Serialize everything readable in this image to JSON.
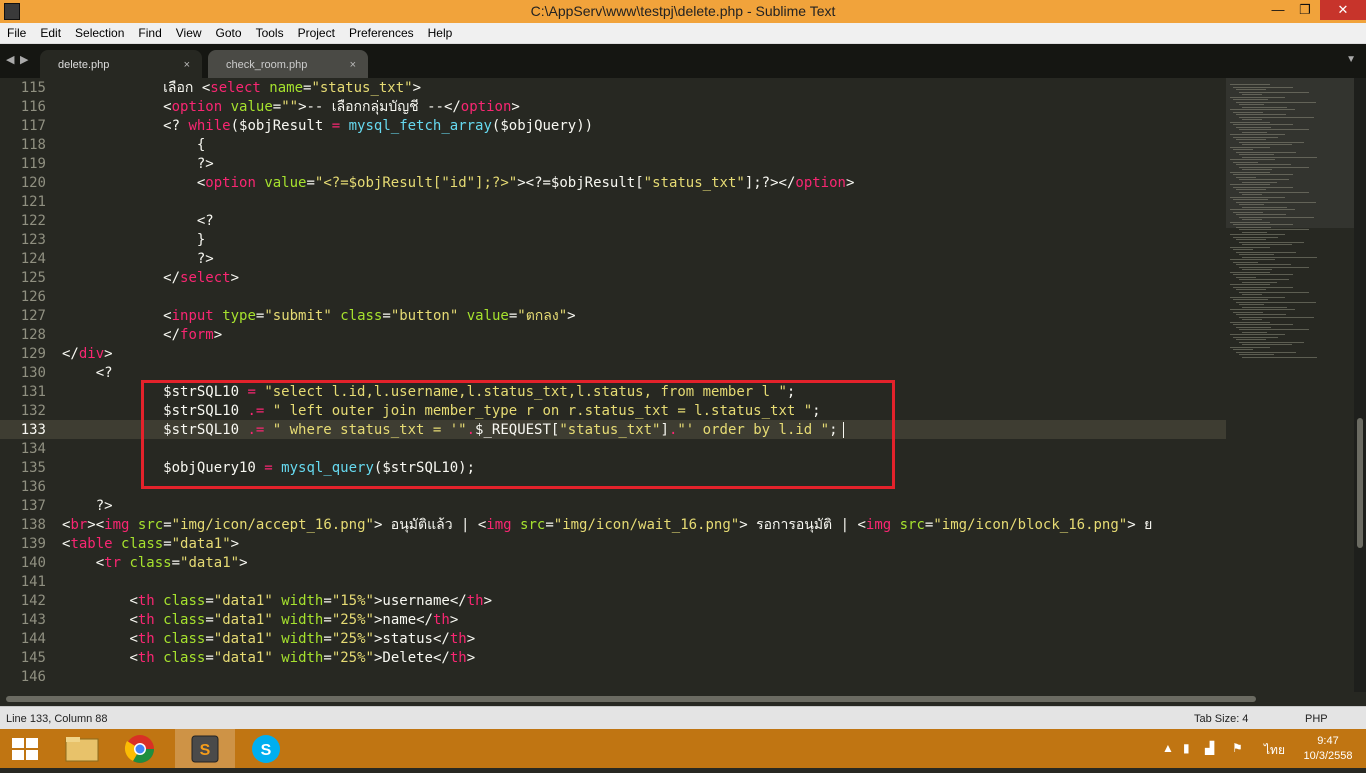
{
  "window": {
    "title": "C:\\AppServ\\www\\testpj\\delete.php - Sublime Text",
    "minimize": "—",
    "maximize": "❐",
    "close": "✕"
  },
  "menu": [
    "File",
    "Edit",
    "Selection",
    "Find",
    "View",
    "Goto",
    "Tools",
    "Project",
    "Preferences",
    "Help"
  ],
  "tabs": {
    "nav_left": "◀",
    "nav_right": "▶",
    "items": [
      {
        "label": "delete.php",
        "close": "×",
        "active": true
      },
      {
        "label": "check_room.php",
        "close": "×",
        "active": false
      }
    ],
    "dropdown": "▼"
  },
  "editor": {
    "current_line": "133",
    "lines": [
      {
        "n": "115",
        "tokens": [
          {
            "t": "text",
            "v": "            เลือก "
          },
          {
            "t": "punc",
            "v": "<"
          },
          {
            "t": "tag",
            "v": "select"
          },
          {
            "t": "text",
            "v": " "
          },
          {
            "t": "attr",
            "v": "name"
          },
          {
            "t": "punc",
            "v": "="
          },
          {
            "t": "str",
            "v": "\"status_txt\""
          },
          {
            "t": "punc",
            "v": ">"
          }
        ]
      },
      {
        "n": "116",
        "tokens": [
          {
            "t": "text",
            "v": "            "
          },
          {
            "t": "punc",
            "v": "<"
          },
          {
            "t": "tag",
            "v": "option"
          },
          {
            "t": "text",
            "v": " "
          },
          {
            "t": "attr",
            "v": "value"
          },
          {
            "t": "punc",
            "v": "="
          },
          {
            "t": "str",
            "v": "\"\""
          },
          {
            "t": "punc",
            "v": ">"
          },
          {
            "t": "text",
            "v": "-- เลือกกลุ่มบัญชี --"
          },
          {
            "t": "punc",
            "v": "</"
          },
          {
            "t": "tag",
            "v": "option"
          },
          {
            "t": "punc",
            "v": ">"
          }
        ]
      },
      {
        "n": "117",
        "tokens": [
          {
            "t": "text",
            "v": "            <? "
          },
          {
            "t": "kw",
            "v": "while"
          },
          {
            "t": "text",
            "v": "($objResult "
          },
          {
            "t": "op",
            "v": "="
          },
          {
            "t": "text",
            "v": " "
          },
          {
            "t": "func",
            "v": "mysql_fetch_array"
          },
          {
            "t": "text",
            "v": "($objQuery))"
          }
        ]
      },
      {
        "n": "118",
        "tokens": [
          {
            "t": "text",
            "v": "                {"
          }
        ]
      },
      {
        "n": "119",
        "tokens": [
          {
            "t": "text",
            "v": "                ?>"
          }
        ]
      },
      {
        "n": "120",
        "tokens": [
          {
            "t": "text",
            "v": "                "
          },
          {
            "t": "punc",
            "v": "<"
          },
          {
            "t": "tag",
            "v": "option"
          },
          {
            "t": "text",
            "v": " "
          },
          {
            "t": "attr",
            "v": "value"
          },
          {
            "t": "punc",
            "v": "="
          },
          {
            "t": "str",
            "v": "\"<?=$objResult[\"id\"];?>\""
          },
          {
            "t": "punc",
            "v": ">"
          },
          {
            "t": "text",
            "v": "<?=$objResult["
          },
          {
            "t": "str",
            "v": "\"status_txt\""
          },
          {
            "t": "text",
            "v": "];?>"
          },
          {
            "t": "punc",
            "v": "</"
          },
          {
            "t": "tag",
            "v": "option"
          },
          {
            "t": "punc",
            "v": ">"
          }
        ]
      },
      {
        "n": "121",
        "tokens": []
      },
      {
        "n": "122",
        "tokens": [
          {
            "t": "text",
            "v": "                <?"
          }
        ]
      },
      {
        "n": "123",
        "tokens": [
          {
            "t": "text",
            "v": "                }"
          }
        ]
      },
      {
        "n": "124",
        "tokens": [
          {
            "t": "text",
            "v": "                ?>"
          }
        ]
      },
      {
        "n": "125",
        "tokens": [
          {
            "t": "text",
            "v": "            "
          },
          {
            "t": "punc",
            "v": "</"
          },
          {
            "t": "tag",
            "v": "select"
          },
          {
            "t": "punc",
            "v": ">"
          }
        ]
      },
      {
        "n": "126",
        "tokens": []
      },
      {
        "n": "127",
        "tokens": [
          {
            "t": "text",
            "v": "            "
          },
          {
            "t": "punc",
            "v": "<"
          },
          {
            "t": "tag",
            "v": "input"
          },
          {
            "t": "text",
            "v": " "
          },
          {
            "t": "attr",
            "v": "type"
          },
          {
            "t": "punc",
            "v": "="
          },
          {
            "t": "str",
            "v": "\"submit\""
          },
          {
            "t": "text",
            "v": " "
          },
          {
            "t": "attr",
            "v": "class"
          },
          {
            "t": "punc",
            "v": "="
          },
          {
            "t": "str",
            "v": "\"button\""
          },
          {
            "t": "text",
            "v": " "
          },
          {
            "t": "attr",
            "v": "value"
          },
          {
            "t": "punc",
            "v": "="
          },
          {
            "t": "str",
            "v": "\"ตกลง\""
          },
          {
            "t": "punc",
            "v": ">"
          }
        ]
      },
      {
        "n": "128",
        "tokens": [
          {
            "t": "text",
            "v": "            "
          },
          {
            "t": "punc",
            "v": "</"
          },
          {
            "t": "tag",
            "v": "form"
          },
          {
            "t": "punc",
            "v": ">"
          }
        ]
      },
      {
        "n": "129",
        "tokens": [
          {
            "t": "punc",
            "v": "</"
          },
          {
            "t": "tag",
            "v": "div"
          },
          {
            "t": "punc",
            "v": ">"
          }
        ]
      },
      {
        "n": "130",
        "tokens": [
          {
            "t": "text",
            "v": "    <?"
          }
        ]
      },
      {
        "n": "131",
        "tokens": [
          {
            "t": "text",
            "v": "            $strSQL10 "
          },
          {
            "t": "op",
            "v": "="
          },
          {
            "t": "text",
            "v": " "
          },
          {
            "t": "str",
            "v": "\"select l.id,l.username,l.status_txt,l.status, from member l \""
          },
          {
            "t": "text",
            "v": ";"
          }
        ]
      },
      {
        "n": "132",
        "tokens": [
          {
            "t": "text",
            "v": "            $strSQL10 "
          },
          {
            "t": "op",
            "v": ".="
          },
          {
            "t": "text",
            "v": " "
          },
          {
            "t": "str",
            "v": "\" left outer join member_type r on r.status_txt = l.status_txt \""
          },
          {
            "t": "text",
            "v": ";"
          }
        ]
      },
      {
        "n": "133",
        "tokens": [
          {
            "t": "text",
            "v": "            $strSQL10 "
          },
          {
            "t": "op",
            "v": ".="
          },
          {
            "t": "text",
            "v": " "
          },
          {
            "t": "str",
            "v": "\" where status_txt = '\""
          },
          {
            "t": "op",
            "v": "."
          },
          {
            "t": "text",
            "v": "$_REQUEST["
          },
          {
            "t": "str",
            "v": "\"status_txt\""
          },
          {
            "t": "text",
            "v": "]"
          },
          {
            "t": "op",
            "v": "."
          },
          {
            "t": "str",
            "v": "\"' order by l.id \""
          },
          {
            "t": "text",
            "v": ";"
          }
        ]
      },
      {
        "n": "134",
        "tokens": []
      },
      {
        "n": "135",
        "tokens": [
          {
            "t": "text",
            "v": "            $objQuery10 "
          },
          {
            "t": "op",
            "v": "="
          },
          {
            "t": "text",
            "v": " "
          },
          {
            "t": "func",
            "v": "mysql_query"
          },
          {
            "t": "text",
            "v": "($strSQL10);"
          }
        ]
      },
      {
        "n": "136",
        "tokens": []
      },
      {
        "n": "137",
        "tokens": [
          {
            "t": "text",
            "v": "    ?>"
          }
        ]
      },
      {
        "n": "138",
        "tokens": [
          {
            "t": "punc",
            "v": "<"
          },
          {
            "t": "tag",
            "v": "br"
          },
          {
            "t": "punc",
            "v": ">"
          },
          {
            "t": "punc",
            "v": "<"
          },
          {
            "t": "tag",
            "v": "img"
          },
          {
            "t": "text",
            "v": " "
          },
          {
            "t": "attr",
            "v": "src"
          },
          {
            "t": "punc",
            "v": "="
          },
          {
            "t": "str",
            "v": "\"img/icon/accept_16.png\""
          },
          {
            "t": "punc",
            "v": ">"
          },
          {
            "t": "text",
            "v": " อนุมัติแล้ว | "
          },
          {
            "t": "punc",
            "v": "<"
          },
          {
            "t": "tag",
            "v": "img"
          },
          {
            "t": "text",
            "v": " "
          },
          {
            "t": "attr",
            "v": "src"
          },
          {
            "t": "punc",
            "v": "="
          },
          {
            "t": "str",
            "v": "\"img/icon/wait_16.png\""
          },
          {
            "t": "punc",
            "v": ">"
          },
          {
            "t": "text",
            "v": " รอการอนุมัติ | "
          },
          {
            "t": "punc",
            "v": "<"
          },
          {
            "t": "tag",
            "v": "img"
          },
          {
            "t": "text",
            "v": " "
          },
          {
            "t": "attr",
            "v": "src"
          },
          {
            "t": "punc",
            "v": "="
          },
          {
            "t": "str",
            "v": "\"img/icon/block_16.png\""
          },
          {
            "t": "punc",
            "v": ">"
          },
          {
            "t": "text",
            "v": " ย"
          }
        ]
      },
      {
        "n": "139",
        "tokens": [
          {
            "t": "punc",
            "v": "<"
          },
          {
            "t": "tag",
            "v": "table"
          },
          {
            "t": "text",
            "v": " "
          },
          {
            "t": "attr",
            "v": "class"
          },
          {
            "t": "punc",
            "v": "="
          },
          {
            "t": "str",
            "v": "\"data1\""
          },
          {
            "t": "punc",
            "v": ">"
          }
        ]
      },
      {
        "n": "140",
        "tokens": [
          {
            "t": "text",
            "v": "    "
          },
          {
            "t": "punc",
            "v": "<"
          },
          {
            "t": "tag",
            "v": "tr"
          },
          {
            "t": "text",
            "v": " "
          },
          {
            "t": "attr",
            "v": "class"
          },
          {
            "t": "punc",
            "v": "="
          },
          {
            "t": "str",
            "v": "\"data1\""
          },
          {
            "t": "punc",
            "v": ">"
          }
        ]
      },
      {
        "n": "141",
        "tokens": []
      },
      {
        "n": "142",
        "tokens": [
          {
            "t": "text",
            "v": "        "
          },
          {
            "t": "punc",
            "v": "<"
          },
          {
            "t": "tag",
            "v": "th"
          },
          {
            "t": "text",
            "v": " "
          },
          {
            "t": "attr",
            "v": "class"
          },
          {
            "t": "punc",
            "v": "="
          },
          {
            "t": "str",
            "v": "\"data1\""
          },
          {
            "t": "text",
            "v": " "
          },
          {
            "t": "attr",
            "v": "width"
          },
          {
            "t": "punc",
            "v": "="
          },
          {
            "t": "str",
            "v": "\"15%\""
          },
          {
            "t": "punc",
            "v": ">"
          },
          {
            "t": "text",
            "v": "username"
          },
          {
            "t": "punc",
            "v": "</"
          },
          {
            "t": "tag",
            "v": "th"
          },
          {
            "t": "punc",
            "v": ">"
          }
        ]
      },
      {
        "n": "143",
        "tokens": [
          {
            "t": "text",
            "v": "        "
          },
          {
            "t": "punc",
            "v": "<"
          },
          {
            "t": "tag",
            "v": "th"
          },
          {
            "t": "text",
            "v": " "
          },
          {
            "t": "attr",
            "v": "class"
          },
          {
            "t": "punc",
            "v": "="
          },
          {
            "t": "str",
            "v": "\"data1\""
          },
          {
            "t": "text",
            "v": " "
          },
          {
            "t": "attr",
            "v": "width"
          },
          {
            "t": "punc",
            "v": "="
          },
          {
            "t": "str",
            "v": "\"25%\""
          },
          {
            "t": "punc",
            "v": ">"
          },
          {
            "t": "text",
            "v": "name"
          },
          {
            "t": "punc",
            "v": "</"
          },
          {
            "t": "tag",
            "v": "th"
          },
          {
            "t": "punc",
            "v": ">"
          }
        ]
      },
      {
        "n": "144",
        "tokens": [
          {
            "t": "text",
            "v": "        "
          },
          {
            "t": "punc",
            "v": "<"
          },
          {
            "t": "tag",
            "v": "th"
          },
          {
            "t": "text",
            "v": " "
          },
          {
            "t": "attr",
            "v": "class"
          },
          {
            "t": "punc",
            "v": "="
          },
          {
            "t": "str",
            "v": "\"data1\""
          },
          {
            "t": "text",
            "v": " "
          },
          {
            "t": "attr",
            "v": "width"
          },
          {
            "t": "punc",
            "v": "="
          },
          {
            "t": "str",
            "v": "\"25%\""
          },
          {
            "t": "punc",
            "v": ">"
          },
          {
            "t": "text",
            "v": "status"
          },
          {
            "t": "punc",
            "v": "</"
          },
          {
            "t": "tag",
            "v": "th"
          },
          {
            "t": "punc",
            "v": ">"
          }
        ]
      },
      {
        "n": "145",
        "tokens": [
          {
            "t": "text",
            "v": "        "
          },
          {
            "t": "punc",
            "v": "<"
          },
          {
            "t": "tag",
            "v": "th"
          },
          {
            "t": "text",
            "v": " "
          },
          {
            "t": "attr",
            "v": "class"
          },
          {
            "t": "punc",
            "v": "="
          },
          {
            "t": "str",
            "v": "\"data1\""
          },
          {
            "t": "text",
            "v": " "
          },
          {
            "t": "attr",
            "v": "width"
          },
          {
            "t": "punc",
            "v": "="
          },
          {
            "t": "str",
            "v": "\"25%\""
          },
          {
            "t": "punc",
            "v": ">"
          },
          {
            "t": "text",
            "v": "Delete"
          },
          {
            "t": "punc",
            "v": "</"
          },
          {
            "t": "tag",
            "v": "th"
          },
          {
            "t": "punc",
            "v": ">"
          }
        ]
      },
      {
        "n": "146",
        "tokens": []
      }
    ]
  },
  "status": {
    "position": "Line 133, Column 88",
    "tab_size": "Tab Size: 4",
    "syntax": "PHP"
  },
  "taskbar": {
    "apps": [
      {
        "name": "start-button-icon"
      },
      {
        "name": "file-explorer-icon"
      },
      {
        "name": "chrome-icon"
      },
      {
        "name": "sublime-text-icon",
        "active": true
      },
      {
        "name": "skype-icon"
      }
    ],
    "tray": {
      "up_arrow": "▲",
      "lang": "ไทย",
      "time": "9:47",
      "date": "10/3/2558"
    }
  },
  "colors": {
    "editor_bg": "#272822",
    "highlight_box": "#e3222b",
    "titlebar": "#f1a33b",
    "taskbar": "#c07512"
  }
}
